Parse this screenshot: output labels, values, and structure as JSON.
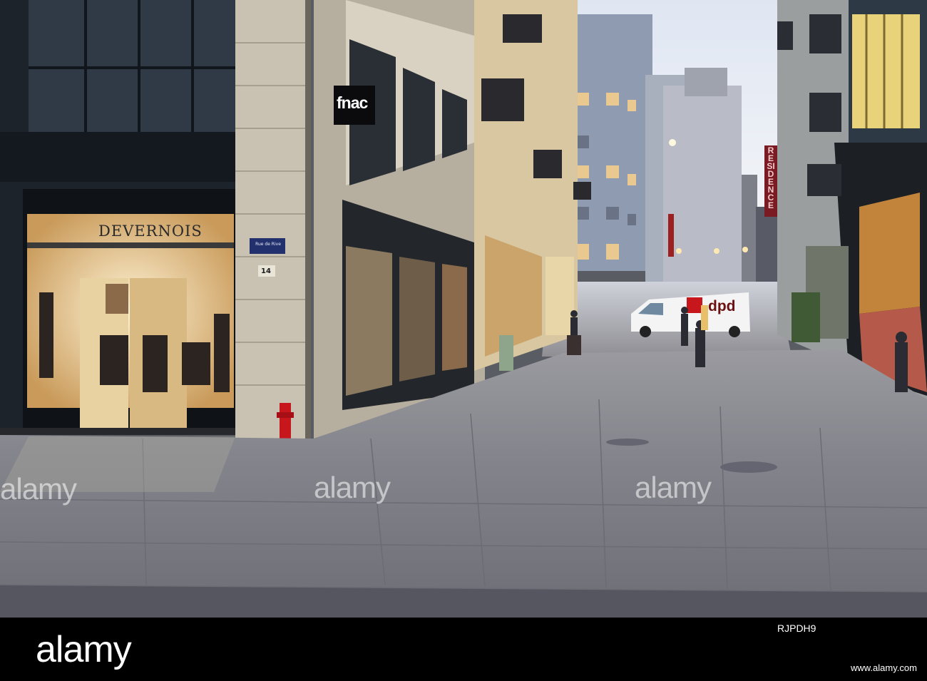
{
  "photo": {
    "shop_sign": "DEVERNOIS",
    "store_sign": "fnac",
    "street_sign": "Rue de Rive",
    "building_number": "14",
    "van_logo": "dpd",
    "hotel_vertical_sign": "RESIDENCE",
    "watermarks": [
      "alamy",
      "alamy",
      "alamy"
    ]
  },
  "footer": {
    "logo": "alamy",
    "image_id": "RJPDH9",
    "url": "www.alamy.com"
  },
  "colors": {
    "sky": "#e9edf5",
    "pavement": "#7c7d86",
    "shop_glow": "#f2d9a6",
    "hydrant": "#c8161d",
    "footer_bg": "#000000"
  }
}
